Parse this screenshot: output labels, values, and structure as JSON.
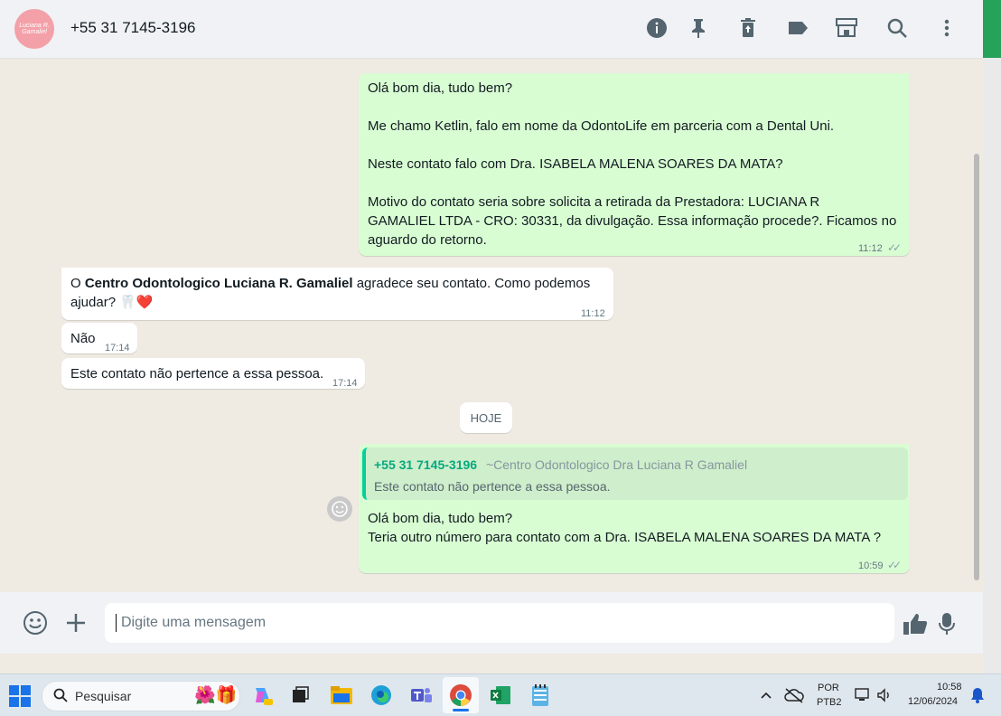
{
  "header": {
    "avatar_text": "Luciana R. Gamaliel",
    "contact": "+55 31 7145-3196",
    "icons": [
      "info-icon",
      "pin-icon",
      "delete-icon",
      "label-icon",
      "store-icon",
      "search-icon",
      "menu-icon"
    ]
  },
  "messages": [
    {
      "type": "out",
      "lines": [
        "Olá bom dia, tudo bem?",
        "Me chamo Ketlin, falo em nome da OdontoLife em parceria com a Dental Uni.",
        "Neste contato falo com Dra. ISABELA MALENA SOARES DA MATA?",
        "Motivo do contato seria sobre solicita a retirada da Prestadora:  LUCIANA R",
        "GAMALIEL LTDA - CRO: 30331, da divulgação. Essa informação procede?. Ficamos no",
        "aguardo do retorno."
      ],
      "time": "11:12"
    },
    {
      "type": "in",
      "prefix": "O ",
      "bold": "Centro Odontologico Luciana R. Gamaliel",
      "suffix": " agradece seu contato. Como podemos",
      "line2": "ajudar? 🦷❤️",
      "time": "11:12"
    },
    {
      "type": "in",
      "text": "Não",
      "time": "17:14"
    },
    {
      "type": "in",
      "text": "Este contato não pertence a essa pessoa.",
      "time": "17:14"
    },
    {
      "type": "out",
      "quote": {
        "author": "+55 31 7145-3196",
        "tag": "~Centro Odontologico Dra Luciana R Gamaliel",
        "text": "Este contato não pertence a essa pessoa."
      },
      "lines": [
        "Olá bom dia, tudo bem?",
        "Teria outro número para contato com a Dra. ISABELA MALENA SOARES DA MATA ?"
      ],
      "time": "10:59"
    }
  ],
  "day_divider": "HOJE",
  "composer": {
    "placeholder": "Digite uma mensagem"
  },
  "taskbar": {
    "search_placeholder": "Pesquisar",
    "lang": "POR",
    "layout": "PTB2",
    "time": "10:58",
    "date": "12/06/2024"
  }
}
